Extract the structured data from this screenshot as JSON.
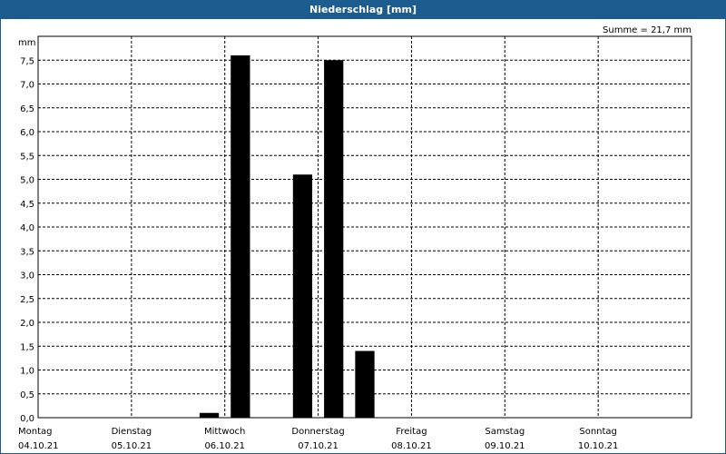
{
  "title": "Niederschlag [mm]",
  "summary": "Summe = 21,7 mm",
  "colors": {
    "titlebar": "#1c5c8e",
    "bars": "#000000",
    "grid": "#000000"
  },
  "chart_data": {
    "type": "bar",
    "title": "Niederschlag [mm]",
    "ylabel": "mm",
    "xlabel": "",
    "ylim": [
      0,
      8
    ],
    "yticks": [
      "0,0",
      "0,5",
      "1,0",
      "1,5",
      "2,0",
      "2,5",
      "3,0",
      "3,5",
      "4,0",
      "4,5",
      "5,0",
      "5,5",
      "6,0",
      "6,5",
      "7,0",
      "7,5"
    ],
    "yticks_values": [
      0,
      0.5,
      1,
      1.5,
      2,
      2.5,
      3,
      3.5,
      4,
      4.5,
      5,
      5.5,
      6,
      6.5,
      7,
      7.5
    ],
    "grid": true,
    "days": [
      {
        "weekday": "Montag",
        "date": "04.10.21"
      },
      {
        "weekday": "Dienstag",
        "date": "05.10.21"
      },
      {
        "weekday": "Mittwoch",
        "date": "06.10.21"
      },
      {
        "weekday": "Donnerstag",
        "date": "07.10.21"
      },
      {
        "weekday": "Freitag",
        "date": "08.10.21"
      },
      {
        "weekday": "Samstag",
        "date": "09.10.21"
      },
      {
        "weekday": "Sonntag",
        "date": "10.10.21"
      }
    ],
    "bar_interval_hours": 8,
    "bars": [
      {
        "period_index": 5,
        "value": 0.1
      },
      {
        "period_index": 6,
        "value": 7.6
      },
      {
        "period_index": 8,
        "value": 5.1
      },
      {
        "period_index": 9,
        "value": 7.5
      },
      {
        "period_index": 10,
        "value": 1.4
      }
    ]
  }
}
